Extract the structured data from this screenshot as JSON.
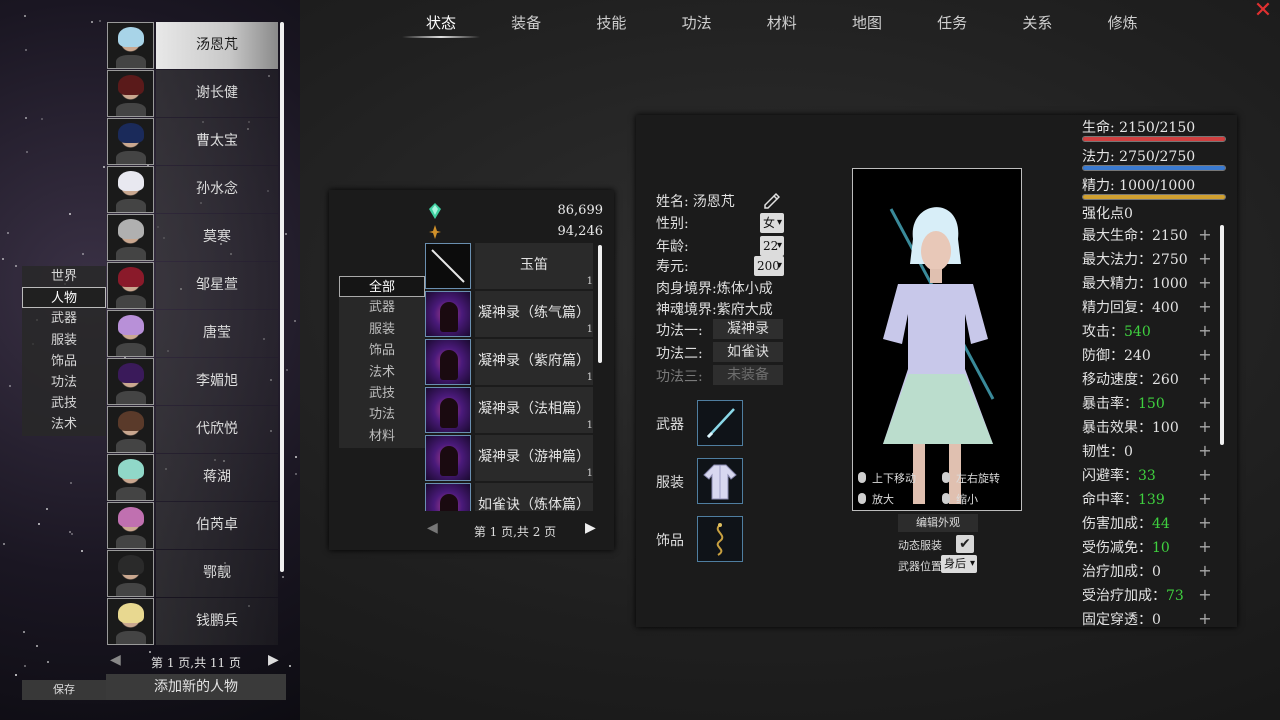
{
  "tabs": [
    {
      "label": "状态",
      "active": true
    },
    {
      "label": "装备"
    },
    {
      "label": "技能"
    },
    {
      "label": "功法"
    },
    {
      "label": "材料"
    },
    {
      "label": "地图"
    },
    {
      "label": "任务"
    },
    {
      "label": "关系"
    },
    {
      "label": "修炼"
    }
  ],
  "close_icon": "✕",
  "left_menu": {
    "items": [
      "世界",
      "人物",
      "武器",
      "服装",
      "饰品",
      "功法",
      "武技",
      "法术"
    ],
    "active": 1
  },
  "characters": {
    "list": [
      {
        "name": "汤恩芃",
        "hair": "#a8d4e8",
        "active": true
      },
      {
        "name": "谢长健",
        "hair": "#5a1a1a"
      },
      {
        "name": "曹太宝",
        "hair": "#1a2a5a"
      },
      {
        "name": "孙水念",
        "hair": "#e8e8f0"
      },
      {
        "name": "莫寒",
        "hair": "#b0b0b0"
      },
      {
        "name": "邹星萱",
        "hair": "#8a1a2a"
      },
      {
        "name": "唐莹",
        "hair": "#b890d8"
      },
      {
        "name": "李媚旭",
        "hair": "#3a1a5a"
      },
      {
        "name": "代欣悦",
        "hair": "#5a3a2a"
      },
      {
        "name": "蒋湖",
        "hair": "#90d8c8"
      },
      {
        "name": "伯芮卓",
        "hair": "#c070b0"
      },
      {
        "name": "鄂靓",
        "hair": "#2a2a2a"
      },
      {
        "name": "钱鹏兵",
        "hair": "#e8d890"
      }
    ],
    "pager": {
      "prev": "◀",
      "text": "第 1 页,共 11 页",
      "next": "▶"
    },
    "save_label": "保存",
    "add_label": "添加新的人物"
  },
  "inventory": {
    "currency": [
      {
        "icon": "spirit-stone-icon",
        "color": "#3fd0a0",
        "value": "86,699"
      },
      {
        "icon": "gold-coin-icon",
        "color": "#d0902a",
        "value": "94,246"
      }
    ],
    "categories": [
      "全部",
      "武器",
      "服装",
      "饰品",
      "法术",
      "武技",
      "功法",
      "材料"
    ],
    "active_category": 0,
    "items": [
      {
        "name": "玉笛",
        "count": "1",
        "kind": "weapon"
      },
      {
        "name": "凝神录（练气篇）",
        "count": "1",
        "kind": "book"
      },
      {
        "name": "凝神录（紫府篇）",
        "count": "1",
        "kind": "book"
      },
      {
        "name": "凝神录（法相篇）",
        "count": "1",
        "kind": "book"
      },
      {
        "name": "凝神录（游神篇）",
        "count": "1",
        "kind": "book"
      },
      {
        "name": "如雀诀（炼体篇）",
        "count": "",
        "kind": "book"
      }
    ],
    "pager": {
      "prev": "◀",
      "text": "第 1 页,共 2 页",
      "next": "▶"
    }
  },
  "profile": {
    "name_label": "姓名:",
    "name": "汤恩芃",
    "gender_label": "性别:",
    "gender": "女",
    "age_label": "年龄:",
    "age": "22",
    "lifespan_label": "寿元:",
    "lifespan": "200",
    "body_label": "肉身境界:",
    "body": "炼体小成",
    "soul_label": "神魂境界:",
    "soul": "紫府大成",
    "skill1_label": "功法一:",
    "skill1": "凝神录",
    "skill2_label": "功法二:",
    "skill2": "如雀诀",
    "skill3_label": "功法三:",
    "skill3": "未装备"
  },
  "equipment": {
    "weapon_label": "武器",
    "clothing_label": "服装",
    "accessory_label": "饰品"
  },
  "model": {
    "move_hint": "上下移动",
    "rotate_hint": "左右旋转",
    "zoom_in_hint": "放大",
    "zoom_out_hint": "缩小",
    "edit_look": "编辑外观",
    "dynamic_outfit": "动态服装",
    "dynamic_checked": "✔",
    "weapon_pos_label": "武器位置",
    "weapon_pos": "身后"
  },
  "bars": [
    {
      "label": "生命: 2150/2150",
      "color": "#d04040",
      "fraction": 1.0
    },
    {
      "label": "法力: 2750/2750",
      "color": "#3a7ad0",
      "fraction": 1.0
    },
    {
      "label": "精力: 1000/1000",
      "color": "#d0a030",
      "fraction": 1.0
    }
  ],
  "points_label": "强化点0",
  "stats": [
    {
      "label": "最大生命：",
      "value": "2150"
    },
    {
      "label": "最大法力：",
      "value": "2750"
    },
    {
      "label": "最大精力：",
      "value": "1000"
    },
    {
      "label": "精力回复：",
      "value": "400"
    },
    {
      "label": "攻击：",
      "value": "540",
      "green": true
    },
    {
      "label": "防御：",
      "value": "240"
    },
    {
      "label": "移动速度：",
      "value": "260"
    },
    {
      "label": "暴击率：",
      "value": "150",
      "green": true
    },
    {
      "label": "暴击效果：",
      "value": "100"
    },
    {
      "label": "韧性：",
      "value": "0"
    },
    {
      "label": "闪避率：",
      "value": "33",
      "green": true
    },
    {
      "label": "命中率：",
      "value": "139",
      "green": true
    },
    {
      "label": "伤害加成：",
      "value": "44",
      "green": true
    },
    {
      "label": "受伤减免：",
      "value": "10",
      "green": true
    },
    {
      "label": "治疗加成：",
      "value": "0"
    },
    {
      "label": "受治疗加成：",
      "value": "73",
      "green": true
    },
    {
      "label": "固定穿透：",
      "value": "0"
    }
  ],
  "plus_glyph": "+"
}
